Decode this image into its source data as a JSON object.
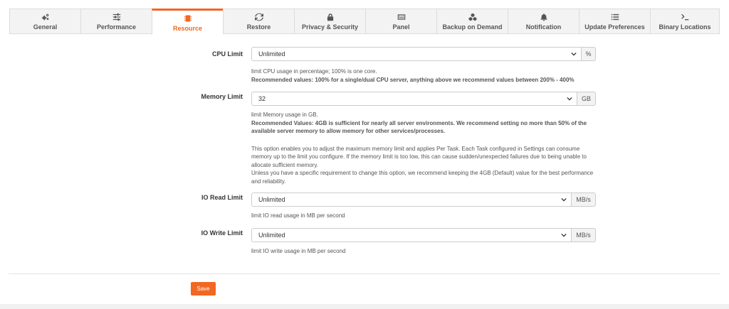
{
  "tabs": [
    {
      "label": "General",
      "icon": "gears-icon"
    },
    {
      "label": "Performance",
      "icon": "sliders-icon"
    },
    {
      "label": "Resource",
      "icon": "chip-icon",
      "active": true
    },
    {
      "label": "Restore",
      "icon": "refresh-icon"
    },
    {
      "label": "Privacy & Security",
      "icon": "lock-icon"
    },
    {
      "label": "Panel",
      "icon": "keyboard-icon"
    },
    {
      "label": "Backup on Demand",
      "icon": "cubes-icon"
    },
    {
      "label": "Notification",
      "icon": "bell-icon"
    },
    {
      "label": "Update Preferences",
      "icon": "list-icon"
    },
    {
      "label": "Binary Locations",
      "icon": "terminal-icon"
    }
  ],
  "accent_color": "#f26722",
  "cpu": {
    "label": "CPU Limit",
    "value": "Unlimited",
    "unit": "%",
    "help": "limit CPU usage in percentage; 100% is one core.",
    "help_bold": "Recommended values: 100% for a single/dual CPU server, anything above we recommend values between 200% - 400%"
  },
  "memory": {
    "label": "Memory Limit",
    "value": "32",
    "unit": "GB",
    "help": "limit Memory usage in GB.",
    "help_bold": "Recommended Values: 4GB is sufficient for nearly all server environments. We recommend setting no more than 50% of the available server memory to allow memory for other services/processes.",
    "note1": "This option enables you to adjust the maximum memory limit and applies Per Task. Each Task configured in Settings can consume memory up to the limit you configure. If the memory limit is too low, this can cause sudden/unexpected failures due to being unable to allocate sufficient memory.",
    "note2": "Unless you have a specific requirement to change this option, we recommend keeping the 4GB (Default) value for the best performance and reliability."
  },
  "io_read": {
    "label": "IO Read Limit",
    "value": "Unlimited",
    "unit": "MB/s",
    "help": "limit IO read usage in MB per second"
  },
  "io_write": {
    "label": "IO Write Limit",
    "value": "Unlimited",
    "unit": "MB/s",
    "help": "limit IO write usage in MB per second"
  },
  "save_label": "Save"
}
